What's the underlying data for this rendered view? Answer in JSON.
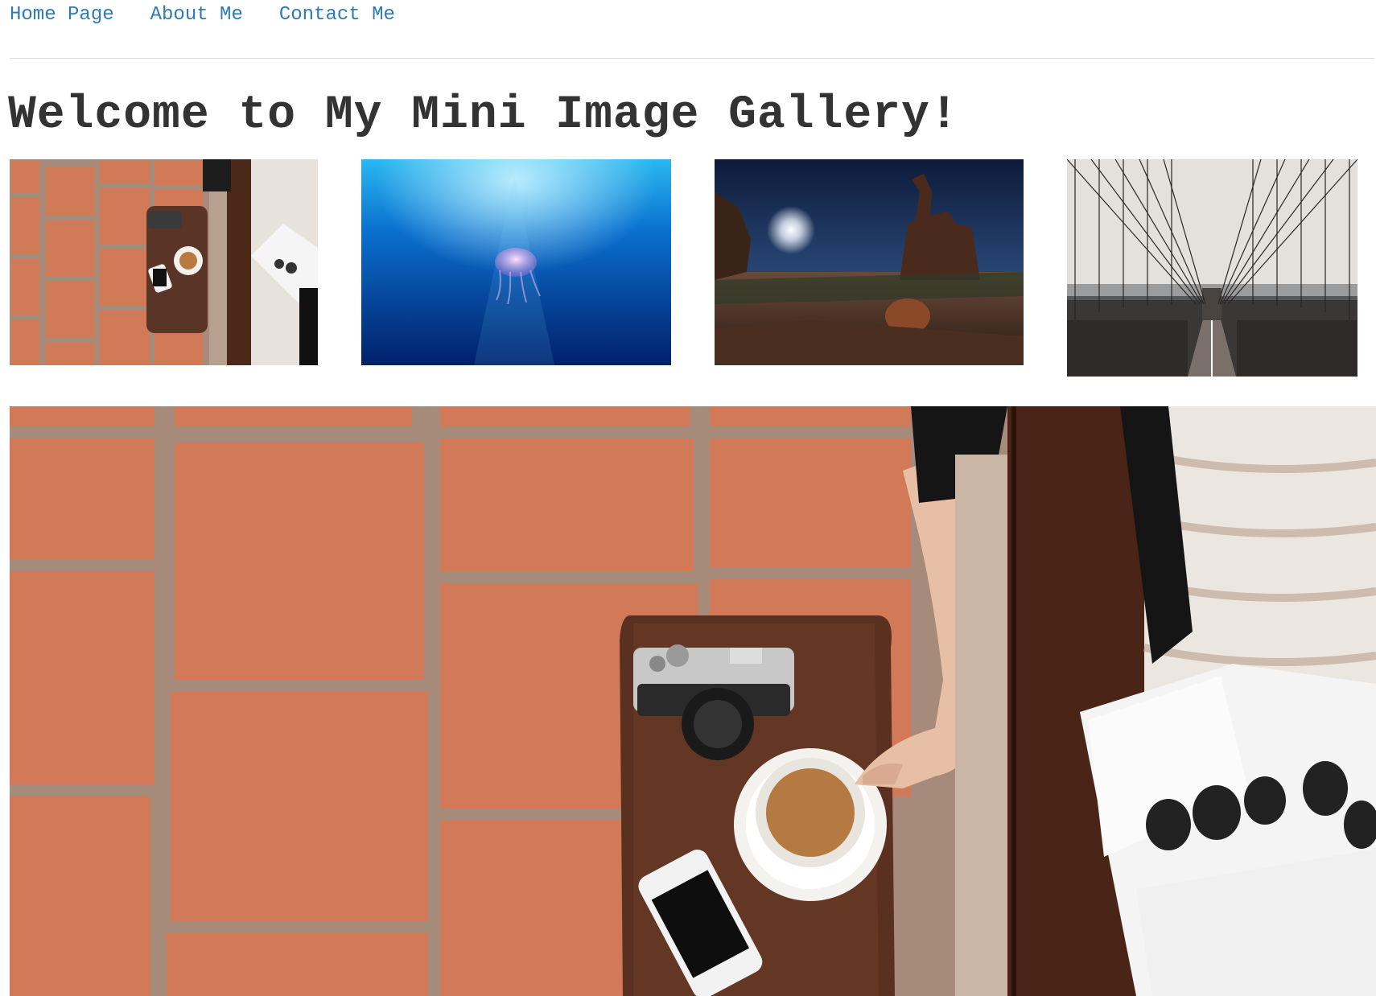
{
  "nav": {
    "items": [
      {
        "label": "Home Page"
      },
      {
        "label": "About Me"
      },
      {
        "label": "Contact Me"
      }
    ],
    "link_color": "#2f7ab5"
  },
  "page": {
    "title": "Welcome to My Mini Image Gallery!"
  },
  "gallery": {
    "thumbnails": [
      {
        "subject": "coffee-table-photo"
      },
      {
        "subject": "jellyfish-underwater-photo"
      },
      {
        "subject": "desert-night-rocks-photo"
      },
      {
        "subject": "suspension-bridge-photo"
      }
    ],
    "selected_index": 0
  },
  "colors": {
    "title": "#333333",
    "tile": "#d27a58",
    "grout": "#a68a7a"
  }
}
